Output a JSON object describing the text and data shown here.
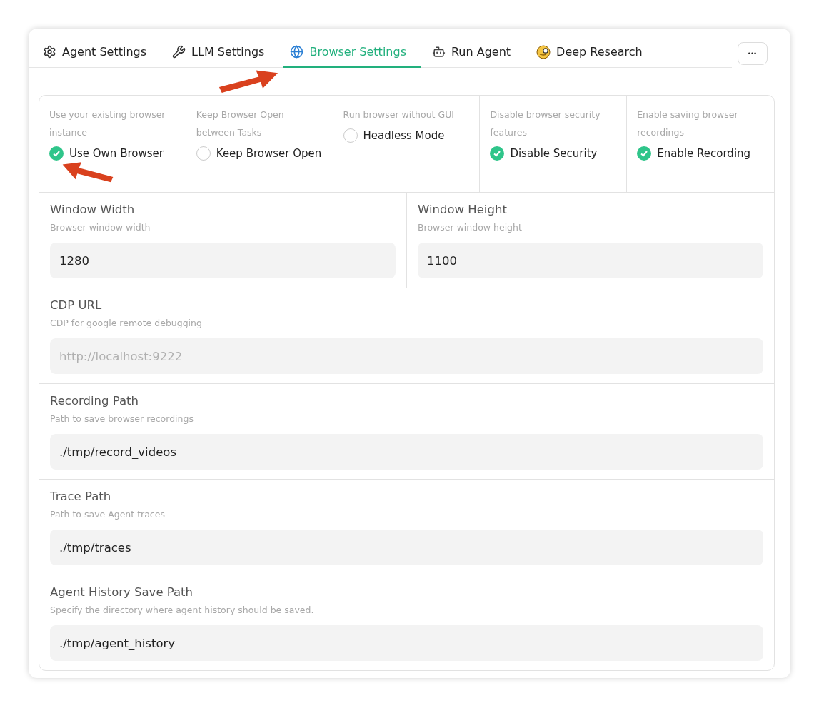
{
  "tabs": [
    {
      "label": "Agent Settings",
      "kind": "gear",
      "selected": false
    },
    {
      "label": "LLM Settings",
      "kind": "wrench",
      "selected": false
    },
    {
      "label": "Browser Settings",
      "kind": "globe",
      "selected": true
    },
    {
      "label": "Run Agent",
      "kind": "robot",
      "selected": false
    },
    {
      "label": "Deep Research",
      "kind": "monocle",
      "selected": false
    }
  ],
  "more_button": "•••",
  "options": [
    {
      "hint": "Use your existing browser instance",
      "label": "Use Own Browser",
      "checked": true
    },
    {
      "hint": "Keep Browser Open between Tasks",
      "label": "Keep Browser Open",
      "checked": false
    },
    {
      "hint": "Run browser without GUI",
      "label": "Headless Mode",
      "checked": false
    },
    {
      "hint": "Disable browser security features",
      "label": "Disable Security",
      "checked": true
    },
    {
      "hint": "Enable saving browser recordings",
      "label": "Enable Recording",
      "checked": true
    }
  ],
  "field_rows": [
    [
      {
        "label": "Window Width",
        "hint": "Browser window width",
        "value": "1280"
      },
      {
        "label": "Window Height",
        "hint": "Browser window height",
        "value": "1100"
      }
    ],
    [
      {
        "label": "CDP URL",
        "hint": "CDP for google remote debugging",
        "placeholder": "http://localhost:9222"
      }
    ],
    [
      {
        "label": "Recording Path",
        "hint": "Path to save browser recordings",
        "value": "./tmp/record_videos"
      }
    ],
    [
      {
        "label": "Trace Path",
        "hint": "Path to save Agent traces",
        "value": "./tmp/traces"
      }
    ],
    [
      {
        "label": "Agent History Save Path",
        "hint": "Specify the directory where agent history should be saved.",
        "value": "./tmp/agent_history"
      }
    ]
  ]
}
